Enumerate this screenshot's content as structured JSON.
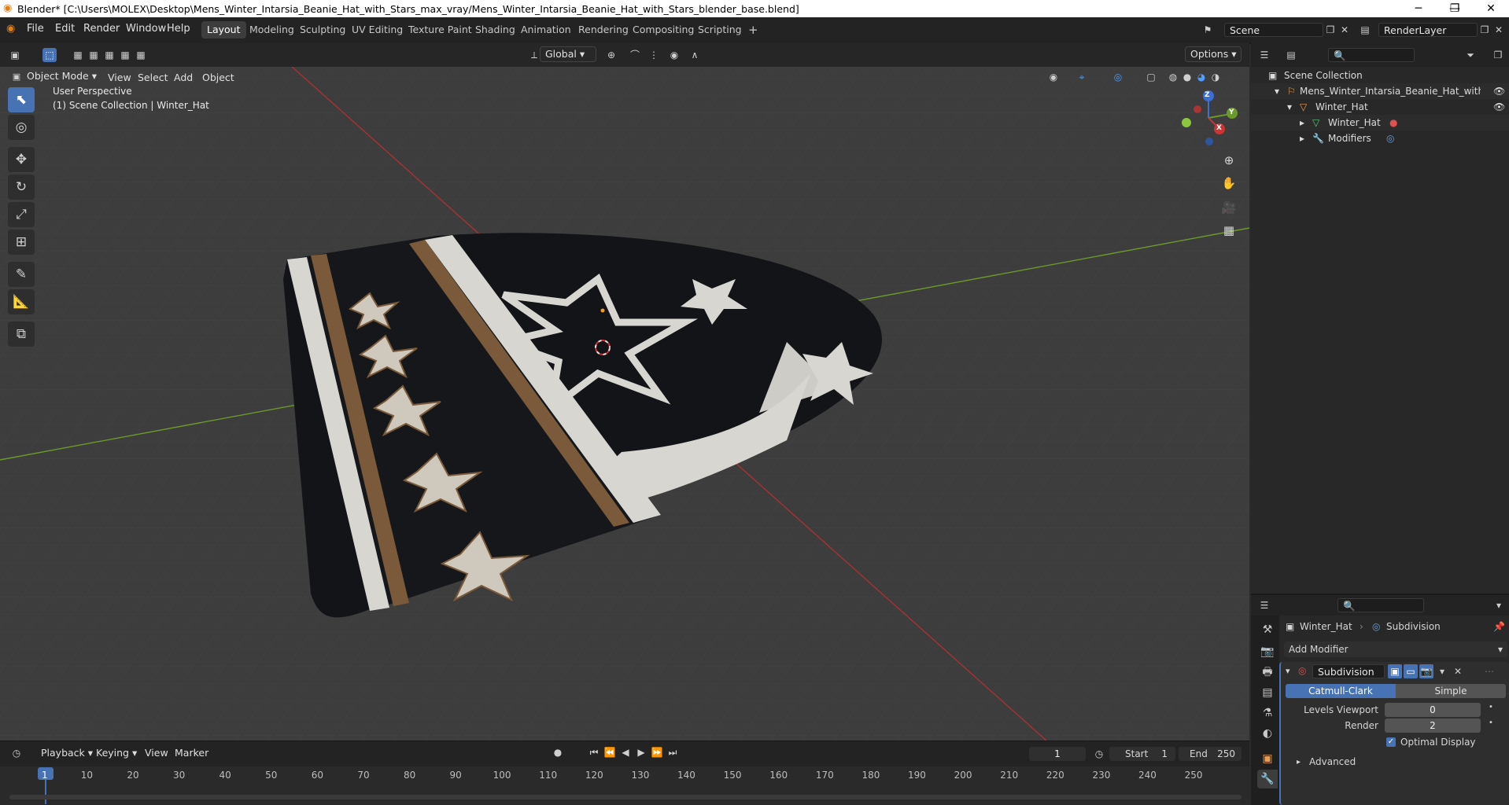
{
  "window": {
    "title": "Blender* [C:\\Users\\MOLEX\\Desktop\\Mens_Winter_Intarsia_Beanie_Hat_with_Stars_max_vray/Mens_Winter_Intarsia_Beanie_Hat_with_Stars_blender_base.blend]"
  },
  "menus": [
    "File",
    "Edit",
    "Render",
    "Window",
    "Help"
  ],
  "workspaces": [
    "Layout",
    "Modeling",
    "Sculpting",
    "UV Editing",
    "Texture Paint",
    "Shading",
    "Animation",
    "Rendering",
    "Compositing",
    "Scripting"
  ],
  "workspace_active": "Layout",
  "scene": {
    "name": "Scene",
    "render_layer": "RenderLayer"
  },
  "viewport": {
    "transform_orientation": "Global",
    "options_label": "Options",
    "mode": "Object Mode",
    "menus": [
      "View",
      "Select",
      "Add",
      "Object"
    ],
    "info_line1": "User Perspective",
    "info_line2": "(1) Scene Collection | Winter_Hat",
    "gizmo": {
      "x": "X",
      "y": "Y",
      "z": "Z"
    },
    "colors": {
      "background": "#3d3d3d",
      "x_axis": "#a83232",
      "y_axis": "#6c9a2a",
      "hat_dark": "#121418",
      "hat_light": "#d8d6d0",
      "hat_brown": "#7a5a3a"
    }
  },
  "outliner": {
    "root": "Scene Collection",
    "items": [
      {
        "label": "Mens_Winter_Intarsia_Beanie_Hat_with_Star",
        "depth": 1
      },
      {
        "label": "Winter_Hat",
        "depth": 2
      },
      {
        "label": "Winter_Hat",
        "depth": 3
      },
      {
        "label": "Modifiers",
        "depth": 3
      }
    ]
  },
  "properties": {
    "breadcrumb_object": "Winter_Hat",
    "breadcrumb_modifier": "Subdivision",
    "add_modifier": "Add Modifier",
    "modifier_name": "Subdivision",
    "type_catmull": "Catmull-Clark",
    "type_simple": "Simple",
    "levels_viewport_label": "Levels Viewport",
    "levels_viewport_value": "0",
    "render_label": "Render",
    "render_value": "2",
    "optimal_display": "Optimal Display",
    "advanced": "Advanced"
  },
  "timeline": {
    "menus": [
      "Playback",
      "Keying",
      "View",
      "Marker"
    ],
    "current_frame": "1",
    "start_label": "Start",
    "start_value": "1",
    "end_label": "End",
    "end_value": "250",
    "ticks": [
      "1",
      "10",
      "20",
      "30",
      "40",
      "50",
      "60",
      "70",
      "80",
      "90",
      "100",
      "110",
      "120",
      "130",
      "140",
      "150",
      "160",
      "170",
      "180",
      "190",
      "200",
      "210",
      "220",
      "230",
      "240",
      "250"
    ]
  }
}
